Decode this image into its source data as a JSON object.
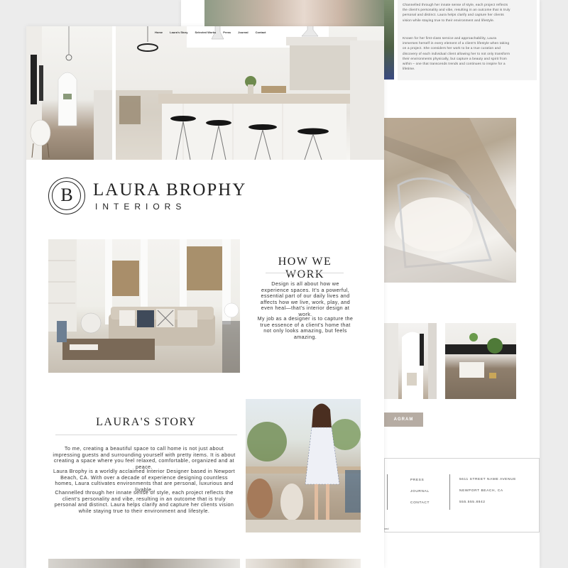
{
  "nav": {
    "items": [
      "Home",
      "Laura's Story",
      "Selected Works",
      "Press",
      "Journal",
      "Contact"
    ]
  },
  "brand": {
    "monogram": "B",
    "name": "LAURA BROPHY",
    "tagline": "INTERIORS"
  },
  "how_we_work": {
    "heading": "HOW WE WORK",
    "para1": "Design is all about how we experience spaces. It's a powerful, essential part of our daily lives and affects how we live, work, play, and even heal—that's interior design at work.",
    "para2": "My job as a designer is to capture the true essence of a client's home that not only looks amazing, but feels amazing."
  },
  "story": {
    "heading": "LAURA'S STORY",
    "para1": "To me, creating a beautiful space to call home is not just about impressing guests and surrounding yourself with pretty items. It is about creating a space where you feel relaxed, comfortable, organized and at peace.",
    "para2": "Laura Brophy is a worldly acclaimed Interior Designer based in Newport Beach, CA. With over a decade of experience designing countless homes, Laura cultivates environments that are personal, luxurious and livable.",
    "para3": "Channelled through her innate sense of style, each project reflects the client's personality and vibe, resulting in an outcome that is truly personal and distinct. Laura helps clarify and capture her clients vision while staying true to their environment and lifestyle."
  },
  "back_page": {
    "text1": "Channelled through her innate sense of style, each project reflects the client's personality and vibe, resulting in an outcome that is truly personal and distinct. Laura helps clarify and capture her clients vision while staying true to their environment and lifestyle.",
    "text2": "Known for her first-class service and approachability, Laura immerses herself in every element of a client's lifestyle when taking on a project. She considers her work to be a true curation and discovery of each individual client allowing her to not only transform their environments physically, but capture a beauty and spirit from within – one that transcends trends and continues to inspire for a lifetime.",
    "instagram_label": "AGRAM",
    "footer_links": [
      "PRESS",
      "JOURNAL",
      "CONTACT"
    ],
    "address": [
      "5611 STREET NAME AVENUE",
      "NEWPORT BEACH, CA",
      "555.555.8842"
    ],
    "footer_fragment": "ved"
  },
  "colors": {
    "accent": "#b6aca3",
    "text": "#333333",
    "background": "#ececec"
  }
}
